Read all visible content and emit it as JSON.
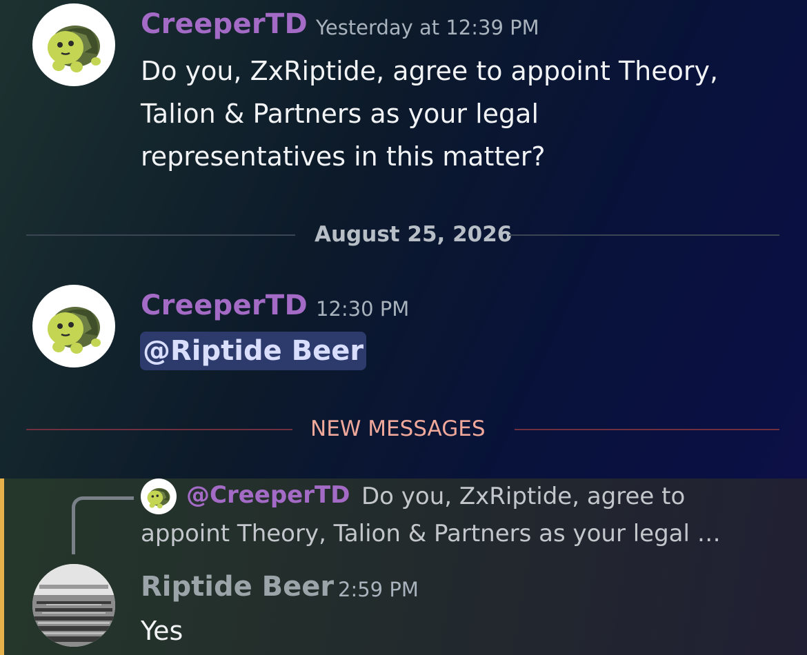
{
  "messages": [
    {
      "author": "CreeperTD",
      "timestamp": "Yesterday at 12:39 PM",
      "lines": [
        "Do you, ZxRiptide, agree to appoint Theory,",
        "Talion & Partners as your legal",
        "representatives in this matter?"
      ],
      "avatar_icon": "turtle-icon"
    },
    {
      "author": "CreeperTD",
      "timestamp": "12:30 PM",
      "mention": "@Riptide Beer",
      "avatar_icon": "turtle-icon"
    },
    {
      "author": "Riptide Beer",
      "timestamp": "2:59 PM",
      "text": "Yes",
      "avatar_icon": "parade-photo-icon",
      "reply": {
        "mention": "@CreeperTD",
        "preview_line1": "Do you, ZxRiptide, agree to",
        "preview_line2": "appoint Theory, Talion & Partners as your legal …"
      }
    }
  ],
  "dividers": {
    "date": "August 25, 2026",
    "new_messages": "NEW MESSAGES"
  },
  "colors": {
    "creeper_name": "#a46bc6",
    "riptide_name": "#9ba5a9",
    "mention_bg": "#2c3b6c",
    "new_messages": "#f0a89a",
    "highlight_bar": "#e6b04a"
  }
}
